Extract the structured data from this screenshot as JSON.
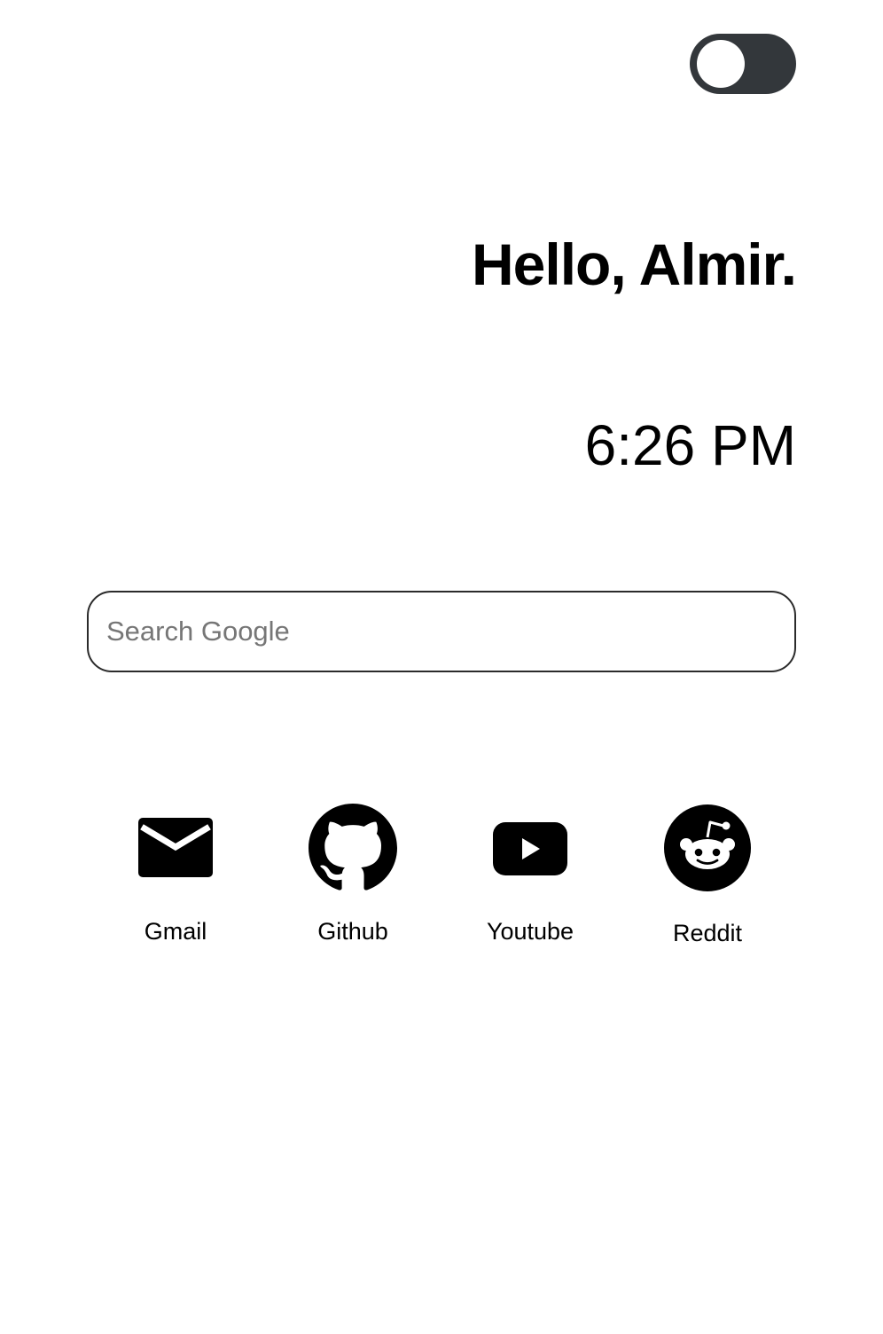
{
  "theme_toggle": {
    "state": "off",
    "track_color": "#33373b",
    "knob_color": "#ffffff"
  },
  "greeting": "Hello, Almir.",
  "clock": "6:26 PM",
  "search": {
    "placeholder": "Search Google",
    "value": ""
  },
  "quick_links": [
    {
      "label": "Gmail",
      "icon": "mail-icon"
    },
    {
      "label": "Github",
      "icon": "github-icon"
    },
    {
      "label": "Youtube",
      "icon": "youtube-icon"
    },
    {
      "label": "Reddit",
      "icon": "reddit-icon"
    }
  ]
}
